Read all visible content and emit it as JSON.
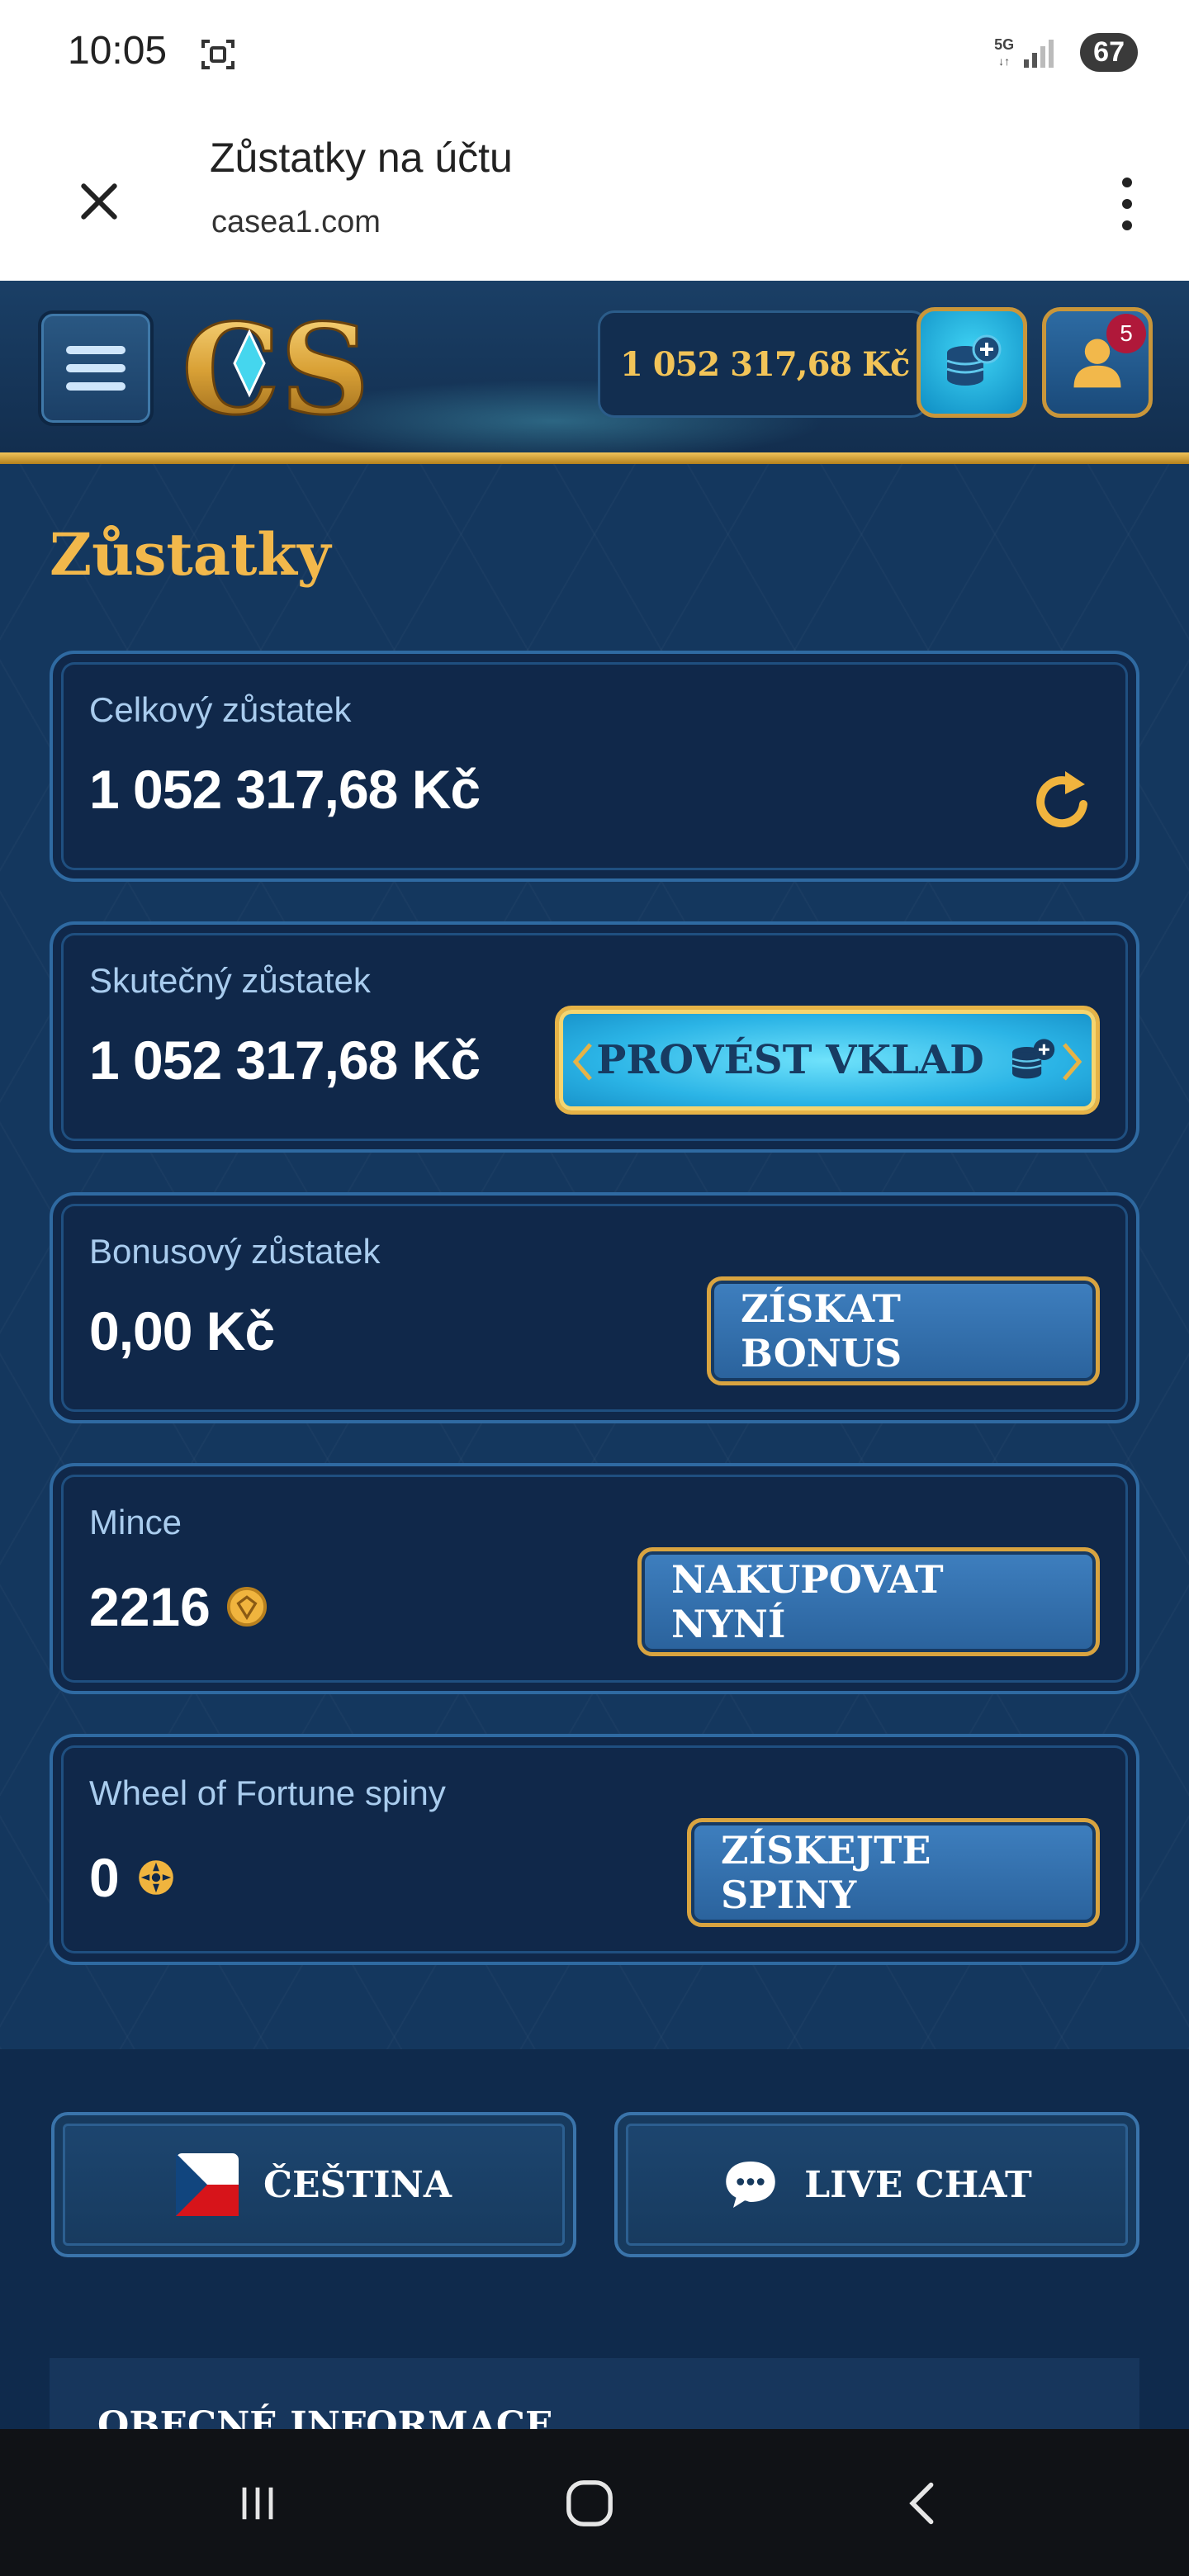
{
  "status_bar": {
    "time": "10:05",
    "network": "5G",
    "battery": "67"
  },
  "browser": {
    "title": "Zůstatky na účtu",
    "url": "casea1.com"
  },
  "header": {
    "logo_text": "CS",
    "balance": "1 052 317,68 Kč",
    "notifications": "5"
  },
  "main": {
    "title": "Zůstatky",
    "cards": [
      {
        "label": "Celkový zůstatek",
        "value": "1 052 317,68 Kč"
      },
      {
        "label": "Skutečný zůstatek",
        "value": "1 052 317,68 Kč",
        "button": "PROVÉST VKLAD"
      },
      {
        "label": "Bonusový zůstatek",
        "value": "0,00 Kč",
        "button": "ZÍSKAT BONUS"
      },
      {
        "label": "Mince",
        "value": "2216",
        "button": "NAKUPOVAT NYNÍ"
      },
      {
        "label": "Wheel of Fortune spiny",
        "value": "0",
        "button": "ZÍSKEJTE SPINY"
      }
    ]
  },
  "footer": {
    "language": "ČEŠTINA",
    "chat": "LIVE CHAT",
    "info": "OBECNÉ INFORMACE"
  },
  "colors": {
    "gold": "#f2b84b",
    "panel": "#10284a",
    "border": "#2f6aa2"
  }
}
